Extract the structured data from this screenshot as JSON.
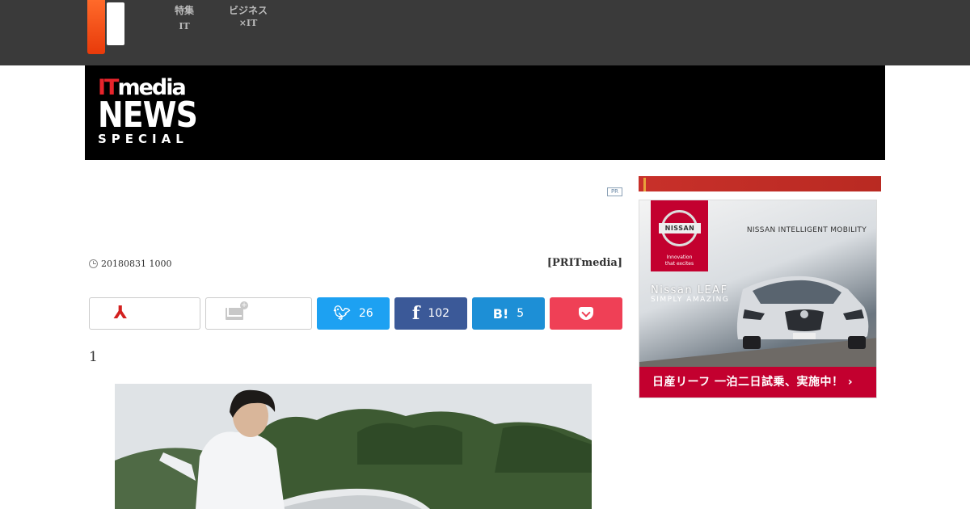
{
  "topnav": {
    "items": [
      {
        "line1": "特集",
        "line2": "IT"
      },
      {
        "line1": "ビジネス",
        "line2": "×IT"
      }
    ]
  },
  "banner": {
    "brand_it": "IT",
    "brand_media": "media",
    "brand_news": "NEWS",
    "brand_special": "SPECIAL"
  },
  "article": {
    "pr_badge": "PR",
    "date": "20180831 1000",
    "author": "[PRITmedia]",
    "paragraph_number": "1"
  },
  "share": {
    "twitter_count": "26",
    "facebook_count": "102",
    "hatena_label": "B!",
    "hatena_count": "5"
  },
  "sidebar": {
    "ad": {
      "brand": "NISSAN",
      "tagline_1": "Innovation",
      "tagline_2": "that excites",
      "mobility": "NISSAN INTELLIGENT MOBILITY",
      "car_title": "Nissan LEAF",
      "car_sub": "SIMPLY AMAZING",
      "cta": "日産リーフ 一泊二日試乗、実施中！ ›"
    }
  },
  "colors": {
    "topbar": "#3a3a3a",
    "twitter": "#1da1f2",
    "facebook": "#3b5998",
    "hatena": "#1d8fd6",
    "pocket": "#ef4056",
    "nissan_red": "#c3002f"
  }
}
